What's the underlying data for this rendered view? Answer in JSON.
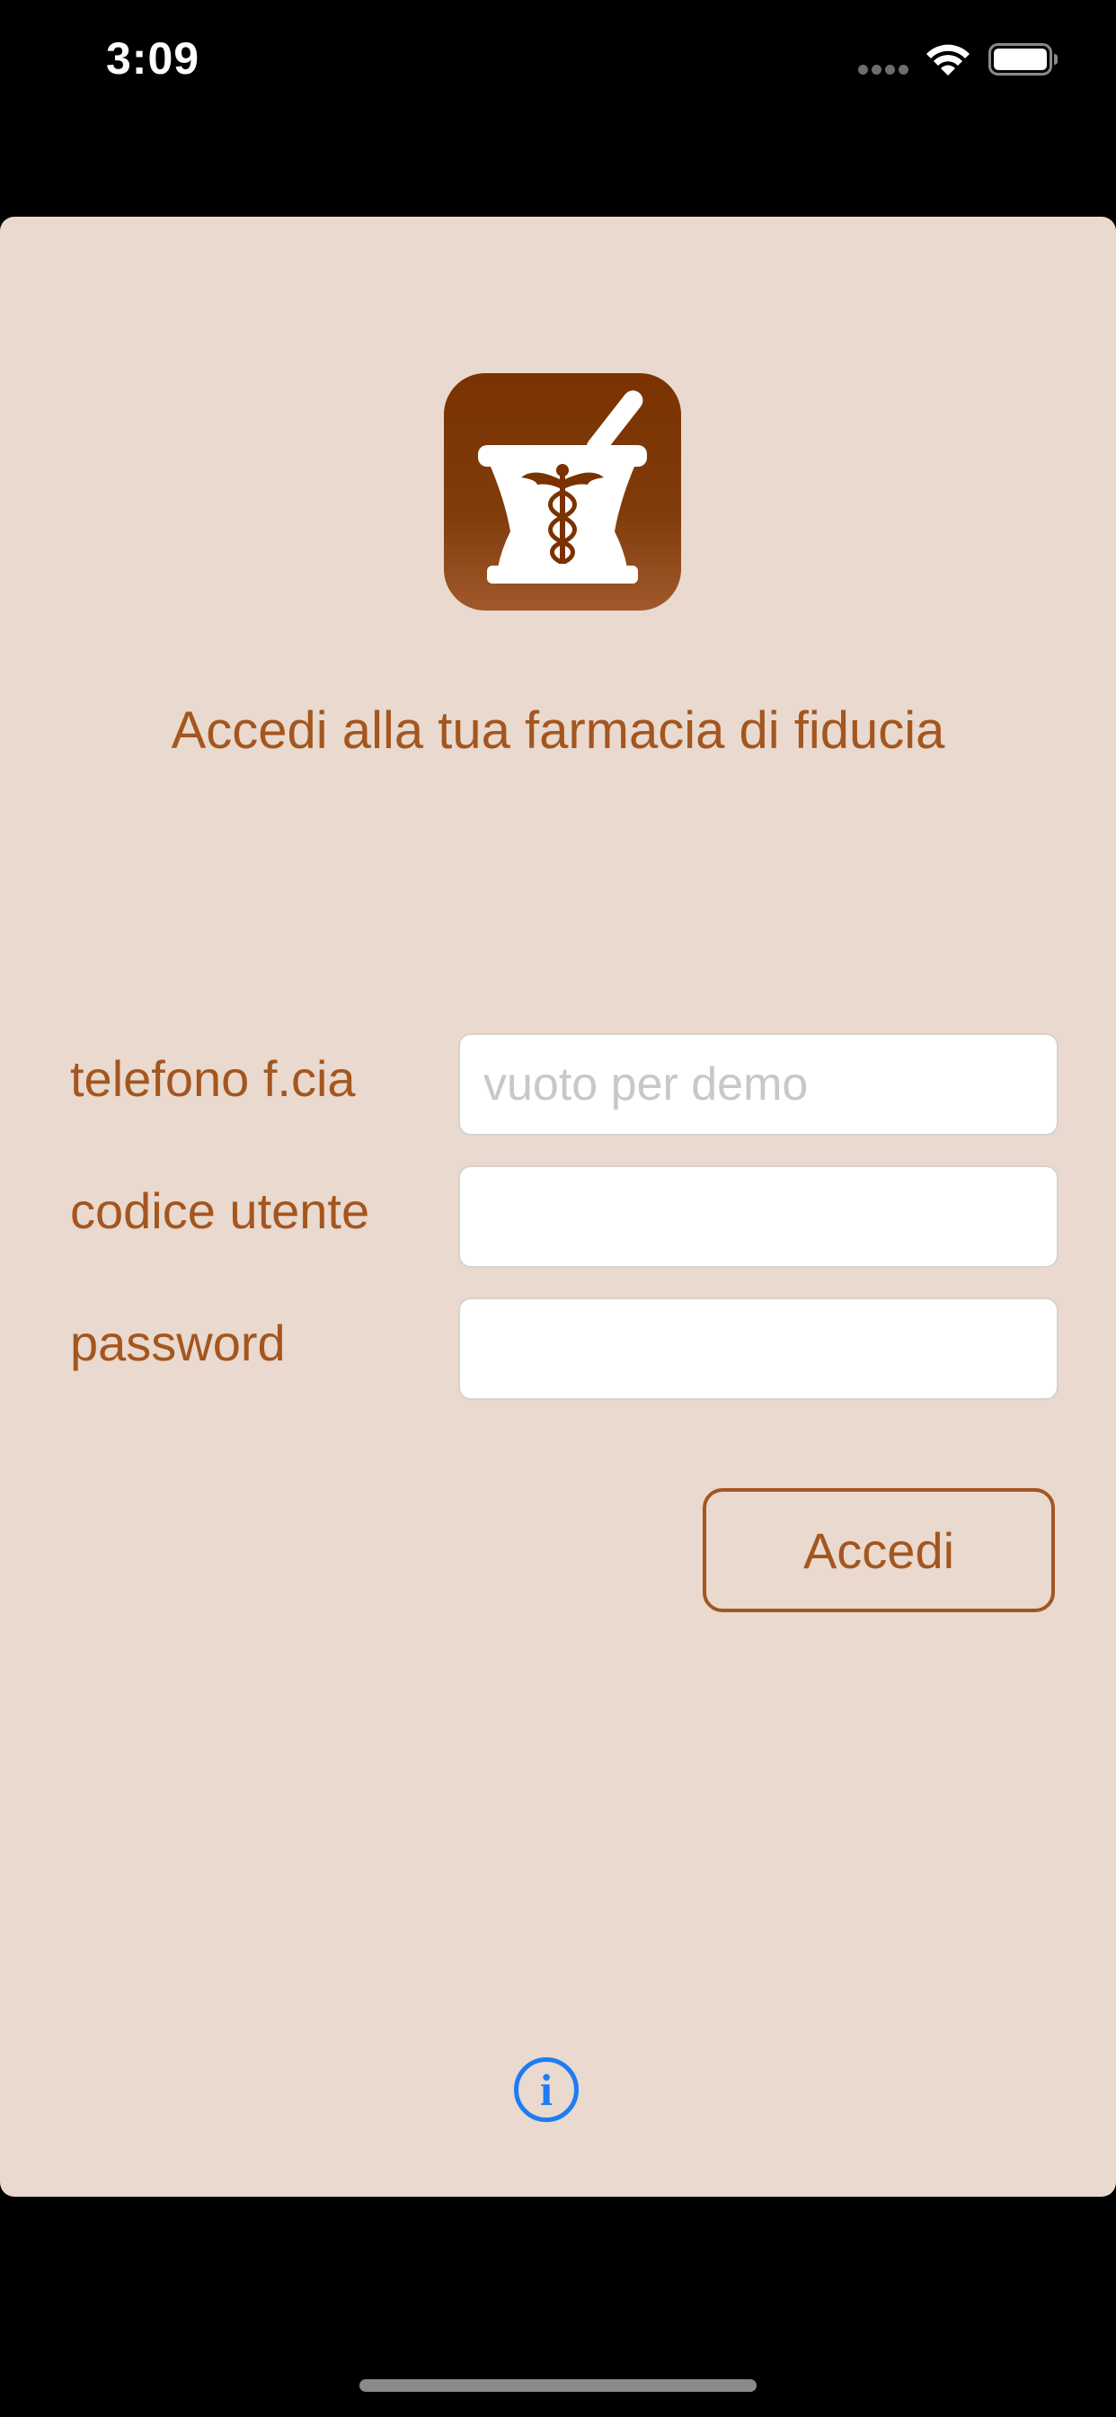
{
  "status_bar": {
    "time": "3:09"
  },
  "login": {
    "welcome_text": "Accedi alla tua farmacia di fiducia",
    "fields": {
      "phone": {
        "label": "telefono f.cia",
        "value": "",
        "placeholder": "vuoto per demo"
      },
      "user_code": {
        "label": "codice utente",
        "value": "",
        "placeholder": ""
      },
      "password": {
        "label": "password",
        "value": "",
        "placeholder": ""
      }
    },
    "submit_label": "Accedi",
    "info_glyph": "i"
  },
  "icons": {
    "logo": "mortar-pestle-caduceus-icon",
    "info": "info-circle-icon",
    "wifi": "wifi-icon",
    "battery": "battery-icon",
    "signal": "cellular-signal-icon"
  },
  "colors": {
    "sheet_background": "#E9D9CE",
    "accent_brown": "#A4561F",
    "logo_brown": "#7A3200",
    "info_blue": "#1E7CF2"
  }
}
